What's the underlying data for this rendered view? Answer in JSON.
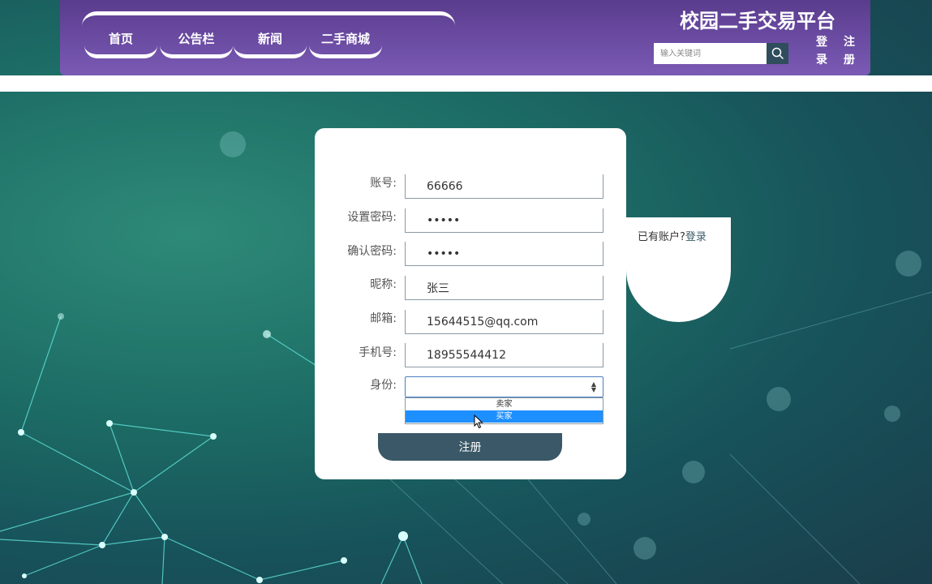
{
  "header": {
    "site_title": "校园二手交易平台",
    "nav_items": [
      {
        "label": "首页"
      },
      {
        "label": "公告栏"
      },
      {
        "label": "新闻"
      },
      {
        "label": "二手商城"
      }
    ],
    "search": {
      "placeholder": "输入关键词",
      "icon": "search-icon"
    },
    "login_label": "登录",
    "register_label": "注册"
  },
  "form": {
    "fields": [
      {
        "label": "账号:",
        "value": "66666"
      },
      {
        "label": "设置密码:",
        "value": "•••••"
      },
      {
        "label": "确认密码:",
        "value": "•••••"
      },
      {
        "label": "昵称:",
        "value": "张三"
      },
      {
        "label": "邮箱:",
        "value": "15644515@qq.com"
      },
      {
        "label": "手机号:",
        "value": "18955544412"
      }
    ],
    "identity": {
      "label": "身份:",
      "selected": "",
      "options": [
        "卖家",
        "买家"
      ],
      "highlighted": "买家"
    },
    "submit_label": "注册"
  },
  "side": {
    "prompt": "已有账户?",
    "login_link": "登录"
  },
  "colors": {
    "header_top": "#5a3c8e",
    "header_bottom": "#7a5ab4",
    "button_dark": "#3a5867",
    "dropdown_highlight": "#1e8fff"
  }
}
